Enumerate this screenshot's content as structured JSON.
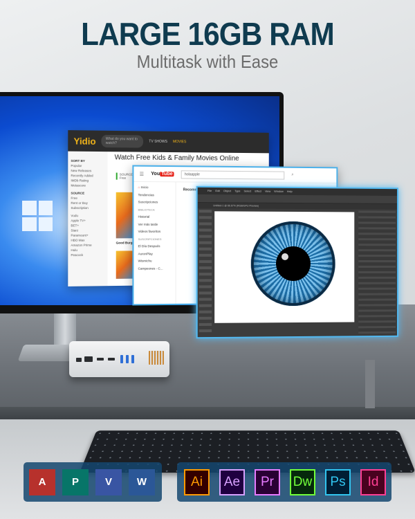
{
  "header": {
    "title": "LARGE 16GB RAM",
    "subtitle": "Multitask with Ease"
  },
  "yidio": {
    "logo": "Yidio",
    "search_placeholder": "What do you want to watch?",
    "nav": [
      "TV SHOWS",
      "MOVIES"
    ],
    "heading": "Watch Free Kids & Family Movies Online",
    "sort_by": "SORT BY",
    "sort_items": [
      "Popular",
      "New Releases",
      "Recently Added",
      "IMDb Rating",
      "Metascore"
    ],
    "source": "SOURCE",
    "source_items": [
      "Free",
      "Rent or Buy",
      "Subscription"
    ],
    "services": [
      "Vudu",
      "Apple TV+",
      "BET+",
      "Starz",
      "Paramount+",
      "HBO Max",
      "Amazon Prime",
      "Hulu",
      "Peacock"
    ],
    "filter_label": "SOURCE",
    "filter_value": "Free",
    "movie_title": "Good Burger"
  },
  "youtube": {
    "logo_text": "You",
    "logo_badge": "Tube",
    "search_value": "holaapple",
    "section": "Recomendados",
    "nav": [
      "Inicio",
      "Tendencias",
      "Suscripciones"
    ],
    "library_header": "BIBLIOTECA",
    "library": [
      "Historial",
      "Ver más tarde",
      "Videos favoritos"
    ],
    "subs_header": "SUSCRIPCIONES",
    "subs": [
      "El Día Después",
      "AuronPlay",
      "Wismichu",
      "Campeones - C..."
    ]
  },
  "illustrator": {
    "menu": [
      "File",
      "Edit",
      "Object",
      "Type",
      "Select",
      "Effect",
      "View",
      "Window",
      "Help"
    ],
    "doc_tab": "Untitled-1 @ 66.67% (RGB/GPU Preview)"
  },
  "apps": {
    "microsoft": [
      {
        "label": "A",
        "name": "access",
        "color": "#b7312c"
      },
      {
        "label": "P",
        "name": "publisher",
        "color": "#077568"
      },
      {
        "label": "V",
        "name": "visio",
        "color": "#3955a3"
      },
      {
        "label": "W",
        "name": "word",
        "color": "#2b5797"
      }
    ],
    "adobe": [
      {
        "label": "Ai",
        "name": "illustrator",
        "color": "#ff9a00",
        "bg": "#330000"
      },
      {
        "label": "Ae",
        "name": "after-effects",
        "color": "#d8a1ff",
        "bg": "#1f0040"
      },
      {
        "label": "Pr",
        "name": "premiere",
        "color": "#e77bff",
        "bg": "#2a0034"
      },
      {
        "label": "Dw",
        "name": "dreamweaver",
        "color": "#72ff3a",
        "bg": "#06290c"
      },
      {
        "label": "Ps",
        "name": "photoshop",
        "color": "#31c5f0",
        "bg": "#001d34"
      },
      {
        "label": "Id",
        "name": "indesign",
        "color": "#ff3f94",
        "bg": "#49021f"
      }
    ]
  }
}
